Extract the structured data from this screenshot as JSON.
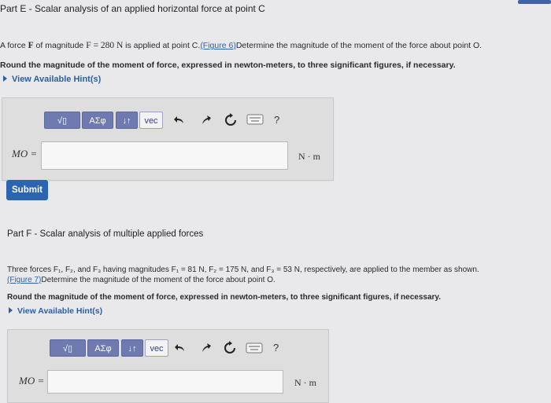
{
  "partE": {
    "title": "Part E - Scalar analysis of an applied horizontal force at point C",
    "text_a": "A force ",
    "force_sym": "F",
    "text_b": " of magnitude ",
    "eq": "F = 280 N",
    "text_c": " is applied at point C.",
    "figure_link": "(Figure 6)",
    "text_d": "Determine the magnitude of the moment of the force about point O.",
    "round_text": "Round the magnitude of the moment of force, expressed in newton-meters, to three significant figures, if necessary.",
    "hint_label": "View Available Hint(s)",
    "answer_label": "MO =",
    "answer_value": "",
    "unit": "N · m",
    "submit_label": "Submit"
  },
  "partF": {
    "title": "Part F - Scalar analysis of multiple applied forces",
    "line1": "Three forces F₁, F₂, and F₃ having magnitudes F₁ = 81 N, F₂ = 175 N, and F₃ = 53 N, respectively, are applied to the member as shown.",
    "figure_link": "(Figure 7)",
    "line2_rest": "Determine the magnitude of the moment of the force about point O.",
    "round_text": "Round the magnitude of the moment of force, expressed in newton-meters, to three significant figures, if necessary.",
    "hint_label": "View Available Hint(s)",
    "answer_label": "MO =",
    "answer_value": "",
    "unit": "N · m"
  },
  "toolbar": {
    "templates_label": "√▯",
    "greek_label": "ΑΣφ",
    "arrows_label": "↓↑",
    "vec_label": "vec",
    "help_label": "?"
  },
  "icons": [
    "undo-icon",
    "redo-icon",
    "reset-icon",
    "keyboard-icon",
    "help-icon",
    "hint-triangle-icon"
  ],
  "colors": {
    "accent": "#2b64b0",
    "toolbar": "#6f7bb0",
    "link": "#2c62a8"
  }
}
